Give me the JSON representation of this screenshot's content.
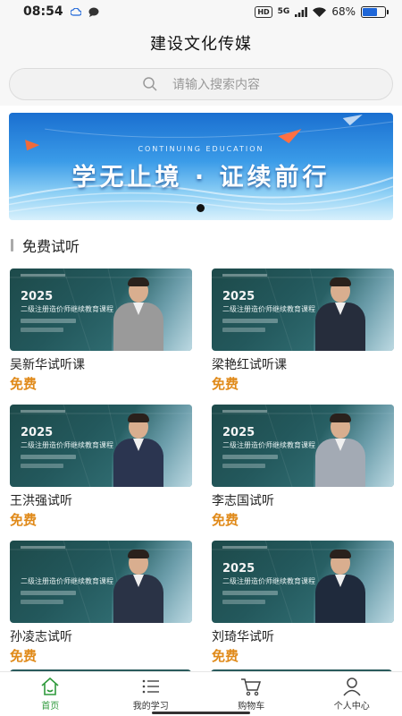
{
  "status": {
    "time": "08:54",
    "network": "5G",
    "hd": "HD",
    "battery": "68%",
    "battery_level": 0.68
  },
  "header": {
    "title": "建设文化传媒"
  },
  "search": {
    "placeholder": "请输入搜索内容",
    "icon": "search-icon"
  },
  "banner": {
    "subtitle": "CONTINUING EDUCATION",
    "headline": "学无止境 · 证续前行"
  },
  "section": {
    "title": "免费试听"
  },
  "courses": [
    {
      "title": "吴新华试听课",
      "price": "免费",
      "year": "2025",
      "course": "二级注册造价师继续教育课程",
      "suit": "#9a9a9a"
    },
    {
      "title": "梁艳红试听课",
      "price": "免费",
      "year": "2025",
      "course": "二级注册造价师继续教育课程",
      "suit": "#262d3c"
    },
    {
      "title": "王洪强试听",
      "price": "免费",
      "year": "2025",
      "course": "二级注册造价师继续教育课程",
      "suit": "#2b3550"
    },
    {
      "title": "李志国试听",
      "price": "免费",
      "year": "2025",
      "course": "二级注册造价师继续教育课程",
      "suit": "#a3aab4"
    },
    {
      "title": "孙凌志试听",
      "price": "免费",
      "year": "",
      "course": "二级注册造价师继续教育课程",
      "suit": "#2a3346"
    },
    {
      "title": "刘琦华试听",
      "price": "免费",
      "year": "2025",
      "course": "二级注册造价师继续教育课程",
      "suit": "#1f2a3c"
    }
  ],
  "tabbar": {
    "items": [
      {
        "label": "首页",
        "icon": "home-icon",
        "active": true
      },
      {
        "label": "我的学习",
        "icon": "list-icon",
        "active": false
      },
      {
        "label": "购物车",
        "icon": "cart-icon",
        "active": false
      },
      {
        "label": "个人中心",
        "icon": "user-icon",
        "active": false
      }
    ]
  },
  "colors": {
    "accent": "#2f9a3c",
    "price": "#e08a1a"
  }
}
